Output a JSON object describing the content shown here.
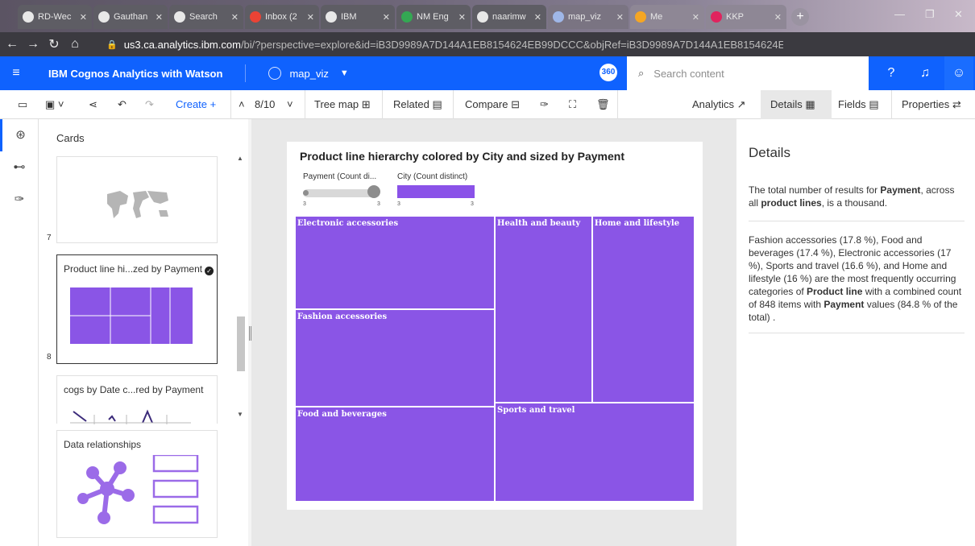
{
  "browser": {
    "tabs": [
      {
        "label": "RD-Wec"
      },
      {
        "label": "Gauthan"
      },
      {
        "label": "Search"
      },
      {
        "label": "Inbox (2"
      },
      {
        "label": "IBM"
      },
      {
        "label": "NM Eng"
      },
      {
        "label": "naarimw"
      },
      {
        "label": "map_viz"
      },
      {
        "label": "Me"
      },
      {
        "label": "KKP"
      }
    ],
    "url_host": "us3.ca.analytics.ibm.com",
    "url_path": "/bi/?perspective=explore&id=iB3D9989A7D144A1EB8154624EB99DCCC&objRef=iB3D9989A7D144A1EB8154624EB99DCC..."
  },
  "app": {
    "title": "IBM Cognos Analytics with Watson",
    "view_name": "map_viz",
    "badge": "360",
    "search_placeholder": "Search content"
  },
  "toolbar": {
    "create_label": "Create",
    "page_counter": "8/10",
    "treemap_label": "Tree map",
    "related_label": "Related",
    "compare_label": "Compare",
    "analytics_label": "Analytics",
    "details_label": "Details",
    "fields_label": "Fields",
    "properties_label": "Properties"
  },
  "cards_panel": {
    "title": "Cards",
    "cards": [
      {
        "number": "7",
        "title": ""
      },
      {
        "number": "8",
        "title": "Product line hi...zed by Payment"
      },
      {
        "number": "",
        "title": "cogs by Date c...red by Payment"
      },
      {
        "number": "",
        "title": "Data relationships"
      }
    ]
  },
  "visualization": {
    "title": "Product line hierarchy colored by City and sized by Payment",
    "legend_size_label": "Payment (Count di...",
    "legend_color_label": "City (Count distinct)",
    "legend_size_min": "3",
    "legend_size_max": "3",
    "legend_color_min": "3",
    "legend_color_max": "3",
    "cell_color": "#8a55e6"
  },
  "chart_data": {
    "type": "treemap",
    "title": "Product line hierarchy colored by City and sized by Payment",
    "series": [
      {
        "name": "Electronic accessories",
        "value": 17
      },
      {
        "name": "Fashion accessories",
        "value": 17.8
      },
      {
        "name": "Food and beverages",
        "value": 17.4
      },
      {
        "name": "Health and beauty",
        "value": 15.2
      },
      {
        "name": "Home and lifestyle",
        "value": 16
      },
      {
        "name": "Sports and travel",
        "value": 16.6
      }
    ]
  },
  "details": {
    "title": "Details",
    "p1_a": "The total number of results for ",
    "p1_b": "Payment",
    "p1_c": ", across all ",
    "p1_d": "product lines",
    "p1_e": ", is a thousand.",
    "p2_a": "Fashion accessories (17.8 %), Food and beverages (17.4 %), Electronic accessories (17 %), Sports and travel (16.6 %), and Home and lifestyle (16 %) are the most frequently occurring categories of ",
    "p2_b": "Product line",
    "p2_c": " with a combined count of 848 items with ",
    "p2_d": "Payment",
    "p2_e": " values (84.8 % of the total) ."
  }
}
